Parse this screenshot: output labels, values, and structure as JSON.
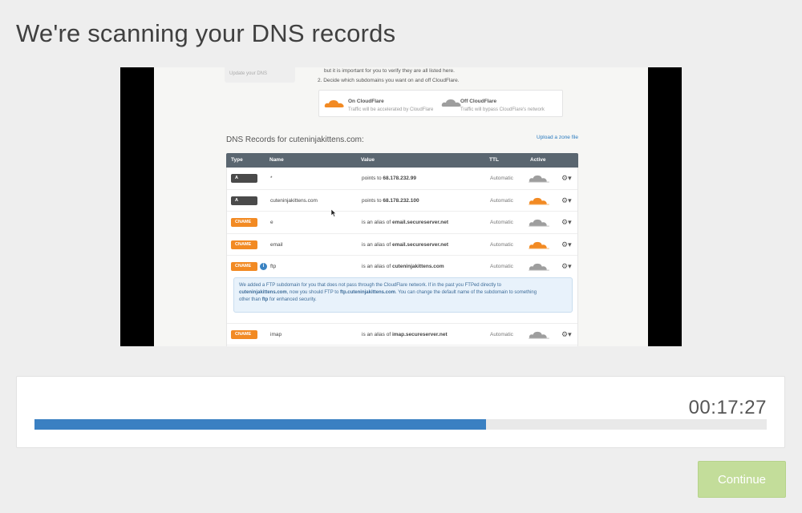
{
  "page": {
    "title": "We're scanning your DNS records"
  },
  "video": {
    "sidebar_text": "Update your DNS",
    "step1_text": "but it is important for you to verify they are all listed here.",
    "step2_text": "2.  Decide which subdomains you want on and off CloudFlare.",
    "legend": {
      "on": {
        "title": "On CloudFlare",
        "desc": "Traffic will be accelerated by CloudFlare",
        "color": "#f28a23"
      },
      "off": {
        "title": "Off CloudFlare",
        "desc": "Traffic will bypass CloudFlare's network",
        "color": "#9e9e9e"
      }
    },
    "dns_title": "DNS Records for cuteninjakittens.com:",
    "upload_link": "Upload a zone file",
    "columns": [
      "Type",
      "Name",
      "Value",
      "TTL",
      "Active"
    ],
    "rows": [
      {
        "type": "A",
        "name": "*",
        "value_prefix": "points to",
        "value": "68.178.232.99",
        "ttl": "Automatic",
        "cloud": "off"
      },
      {
        "type": "A",
        "name": "cuteninjakittens.com",
        "value_prefix": "points to",
        "value": "68.178.232.100",
        "ttl": "Automatic",
        "cloud": "on"
      },
      {
        "type": "CNAME",
        "name": "e",
        "value_prefix": "is an alias of",
        "value": "email.secureserver.net",
        "ttl": "Automatic",
        "cloud": "off"
      },
      {
        "type": "CNAME",
        "name": "email",
        "value_prefix": "is an alias of",
        "value": "email.secureserver.net",
        "ttl": "Automatic",
        "cloud": "on"
      },
      {
        "type": "CNAME",
        "name": "ftp",
        "value_prefix": "is an alias of",
        "value": "cuteninjakittens.com",
        "ttl": "Automatic",
        "cloud": "off",
        "info": "i"
      },
      {
        "type": "CNAME",
        "name": "imap",
        "value_prefix": "is an alias of",
        "value": "imap.secureserver.net",
        "ttl": "Automatic",
        "cloud": "off"
      }
    ],
    "notice": {
      "line1": "We added a FTP subdomain for you that does not pass through the CloudFlare network. If in the past you FTPed directly to",
      "line2_a": "cuteninjakittens.com",
      "line2_b": ", now you should FTP to ",
      "line2_c": "ftp.cuteninjakittens.com",
      "line2_d": ". You can change the default name of the subdomain to something",
      "line3_a": "other than ",
      "line3_b": "ftp",
      "line3_c": " for enhanced security."
    }
  },
  "progress": {
    "time": "00:17:27",
    "fraction": 0.617,
    "color": "#3a80c2"
  },
  "continue_button": {
    "label": "Continue",
    "color": "#c3dd9a"
  }
}
